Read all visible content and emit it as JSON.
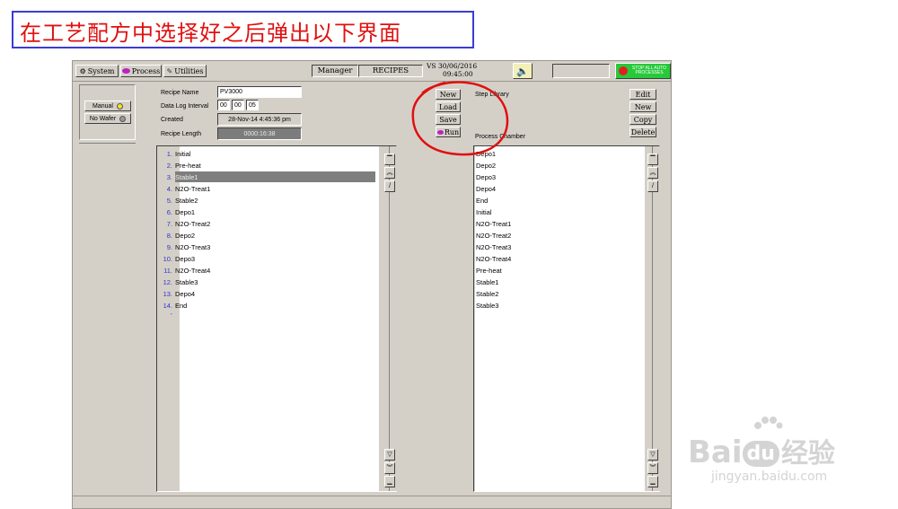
{
  "instruction_banner": "在工艺配方中选择好之后弹出以下界面",
  "toolbar": {
    "system": "System",
    "process": "Process",
    "utilities": "Utilities",
    "user": "Manager",
    "screen": "RECIPES",
    "datetime_top": "VS  30/06/2016",
    "datetime_bottom": "09:45:00",
    "stop_label": "STOP ALL AUTO PROCESSES"
  },
  "mode": {
    "manual": "Manual",
    "wafer": "No Wafer"
  },
  "recipe": {
    "name_label": "Recipe Name",
    "name_value": "PV3000",
    "interval_label": "Data Log Interval",
    "interval": [
      "00",
      "00",
      "05"
    ],
    "created_label": "Created",
    "created_value": "28-Nov-14   4:45:36 pm",
    "length_label": "Recipe Length",
    "length_value": "0000:16:38"
  },
  "actions": {
    "new": "New",
    "load": "Load",
    "save": "Save",
    "run": "Run"
  },
  "library": {
    "title": "Step Library",
    "chamber_label": "Process Chamber",
    "edit": "Edit",
    "new": "New",
    "copy": "Copy",
    "delete": "Delete"
  },
  "steps": [
    {
      "num": "1.",
      "name": "Initial"
    },
    {
      "num": "2.",
      "name": "Pre-heat"
    },
    {
      "num": "3.",
      "name": "Stable1"
    },
    {
      "num": "4.",
      "name": "N2O-Treat1"
    },
    {
      "num": "5.",
      "name": "Stable2"
    },
    {
      "num": "6.",
      "name": "Depo1"
    },
    {
      "num": "7.",
      "name": "N2O-Treat2"
    },
    {
      "num": "8.",
      "name": "Depo2"
    },
    {
      "num": "9.",
      "name": "N2O-Treat3"
    },
    {
      "num": "10.",
      "name": "Depo3"
    },
    {
      "num": "11.",
      "name": "N2O-Treat4"
    },
    {
      "num": "12.",
      "name": "Stable3"
    },
    {
      "num": "13.",
      "name": "Depo4"
    },
    {
      "num": "14.",
      "name": "End"
    }
  ],
  "steps_trailing": "-",
  "library_steps": [
    "Depo1",
    "Depo2",
    "Depo3",
    "Depo4",
    "End",
    "Initial",
    "N2O-Treat1",
    "N2O-Treat2",
    "N2O-Treat3",
    "N2O-Treat4",
    "Pre-heat",
    "Stable1",
    "Stable2",
    "Stable3"
  ],
  "watermark": {
    "brand_latin": "Bai",
    "brand_du": "du",
    "brand_cn": "经验",
    "url": "jingyan.baidu.com"
  },
  "colors": {
    "annotation": "#e01010",
    "banner_border": "#3b3bd6",
    "selection": "#7e7e7e",
    "step_number": "#3333cc",
    "stop_button": "#27c93a"
  }
}
